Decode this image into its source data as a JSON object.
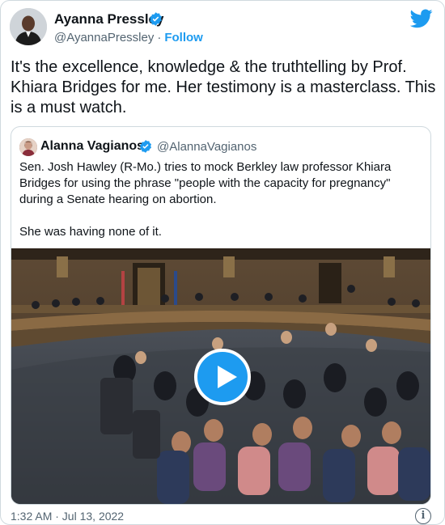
{
  "author": {
    "name": "Ayanna Pressley",
    "handle": "@AyannaPressley",
    "separator": "·",
    "follow_label": "Follow"
  },
  "tweet": {
    "text": "It's the excellence, knowledge & the truthtelling by Prof. Khiara Bridges for me. Her testimony is a masterclass. This is a must watch."
  },
  "quoted_tweet": {
    "author_name": "Alanna Vagianos",
    "author_handle": "@AlannaVagianos",
    "text_paragraph_1": "Sen. Josh Hawley (R-Mo.) tries to mock Berkley law professor Khiara Bridges for using the phrase \"people with the capacity for pregnancy\" during a Senate hearing on abortion.",
    "text_paragraph_2": "She was having none of it."
  },
  "footer": {
    "timestamp": "1:32 AM · Jul 13, 2022",
    "info_glyph": "i"
  },
  "icons": {
    "verified": "verified-badge-icon",
    "brand": "twitter-bird-icon",
    "play": "play-icon",
    "info": "info-icon"
  },
  "colors": {
    "accent": "#1d9bf0",
    "text_primary": "#0f1419",
    "text_secondary": "#536471",
    "border": "#cfd9de"
  }
}
